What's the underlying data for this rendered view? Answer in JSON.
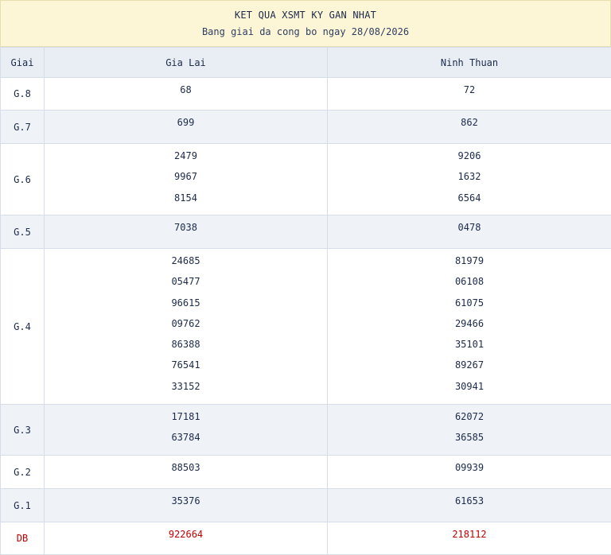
{
  "header": {
    "title": "KET QUA XSMT KY GAN NHAT",
    "subtitle": "Bang giai da cong bo ngay 28/08/2026"
  },
  "columns": [
    "Giai",
    "Gia Lai",
    "Ninh Thuan"
  ],
  "rows": [
    {
      "label": "G.8",
      "gia_lai": [
        "68"
      ],
      "ninh_thuan": [
        "72"
      ]
    },
    {
      "label": "G.7",
      "gia_lai": [
        "699"
      ],
      "ninh_thuan": [
        "862"
      ]
    },
    {
      "label": "G.6",
      "gia_lai": [
        "2479",
        "9967",
        "8154"
      ],
      "ninh_thuan": [
        "9206",
        "1632",
        "6564"
      ]
    },
    {
      "label": "G.5",
      "gia_lai": [
        "7038"
      ],
      "ninh_thuan": [
        "0478"
      ]
    },
    {
      "label": "G.4",
      "gia_lai": [
        "24685",
        "05477",
        "96615",
        "09762",
        "86388",
        "76541",
        "33152"
      ],
      "ninh_thuan": [
        "81979",
        "06108",
        "61075",
        "29466",
        "35101",
        "89267",
        "30941"
      ]
    },
    {
      "label": "G.3",
      "gia_lai": [
        "17181",
        "63784"
      ],
      "ninh_thuan": [
        "62072",
        "36585"
      ]
    },
    {
      "label": "G.2",
      "gia_lai": [
        "88503"
      ],
      "ninh_thuan": [
        "09939"
      ]
    },
    {
      "label": "G.1",
      "gia_lai": [
        "35376"
      ],
      "ninh_thuan": [
        "61653"
      ]
    },
    {
      "label": "DB",
      "gia_lai": [
        "922664"
      ],
      "ninh_thuan": [
        "218112"
      ]
    }
  ]
}
